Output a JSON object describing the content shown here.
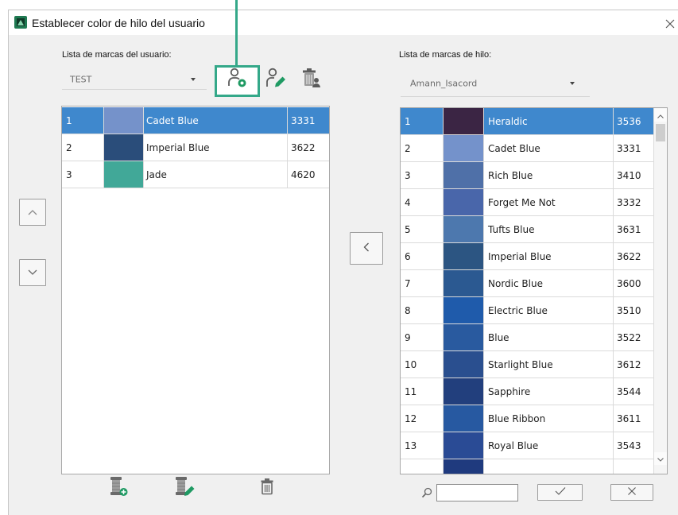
{
  "window": {
    "title": "Establecer color de hilo del usuario"
  },
  "user_brands": {
    "label": "Lista de marcas del usuario:",
    "selected_brand": "TEST",
    "threads": [
      {
        "index": "1",
        "color": "#7592ca",
        "name": "Cadet Blue",
        "code": "3331",
        "selected": true
      },
      {
        "index": "2",
        "color": "#2a4d7a",
        "name": "Imperial Blue",
        "code": "3622",
        "selected": false
      },
      {
        "index": "3",
        "color": "#41a898",
        "name": "Jade",
        "code": "4620",
        "selected": false
      }
    ]
  },
  "thread_brands": {
    "label": "Lista de marcas de hilo:",
    "selected_brand": "Amann_Isacord",
    "threads": [
      {
        "index": "1",
        "color": "#3b2544",
        "name": "Heraldic",
        "code": "3536",
        "selected": true
      },
      {
        "index": "2",
        "color": "#7492cb",
        "name": "Cadet Blue",
        "code": "3331",
        "selected": false
      },
      {
        "index": "3",
        "color": "#4f70a8",
        "name": "Rich Blue",
        "code": "3410",
        "selected": false
      },
      {
        "index": "4",
        "color": "#4966aa",
        "name": "Forget Me Not",
        "code": "3332",
        "selected": false
      },
      {
        "index": "5",
        "color": "#4d78ae",
        "name": "Tufts Blue",
        "code": "3631",
        "selected": false
      },
      {
        "index": "6",
        "color": "#2c5582",
        "name": "Imperial Blue",
        "code": "3622",
        "selected": false
      },
      {
        "index": "7",
        "color": "#2b5991",
        "name": "Nordic Blue",
        "code": "3600",
        "selected": false
      },
      {
        "index": "8",
        "color": "#1f5bab",
        "name": "Electric Blue",
        "code": "3510",
        "selected": false
      },
      {
        "index": "9",
        "color": "#295a9f",
        "name": "Blue",
        "code": "3522",
        "selected": false
      },
      {
        "index": "10",
        "color": "#2a4f8f",
        "name": "Starlight Blue",
        "code": "3612",
        "selected": false
      },
      {
        "index": "11",
        "color": "#223f7d",
        "name": "Sapphire",
        "code": "3544",
        "selected": false
      },
      {
        "index": "12",
        "color": "#2759a1",
        "name": "Blue Ribbon",
        "code": "3611",
        "selected": false
      },
      {
        "index": "13",
        "color": "#2a4b95",
        "name": "Royal Blue",
        "code": "3543",
        "selected": false
      },
      {
        "color": "#1f3a7e",
        "selected": false
      }
    ]
  },
  "search": {
    "value": ""
  },
  "colors": {
    "selection": "#3f88cd",
    "accent_green": "#1f9a63",
    "callout": "#34a889"
  },
  "icons": {
    "app": "app-icon",
    "close": "close-icon",
    "add_user": "add-user-icon",
    "edit_user": "edit-user-icon",
    "delete_user": "delete-user-icon",
    "move_up": "chevron-up-icon",
    "move_down": "chevron-down-icon",
    "copy_left": "chevron-left-icon",
    "add_thread": "add-thread-icon",
    "edit_thread": "edit-thread-icon",
    "delete_thread": "trash-icon",
    "search": "search-icon",
    "accept": "check-icon",
    "cancel": "x-icon"
  }
}
